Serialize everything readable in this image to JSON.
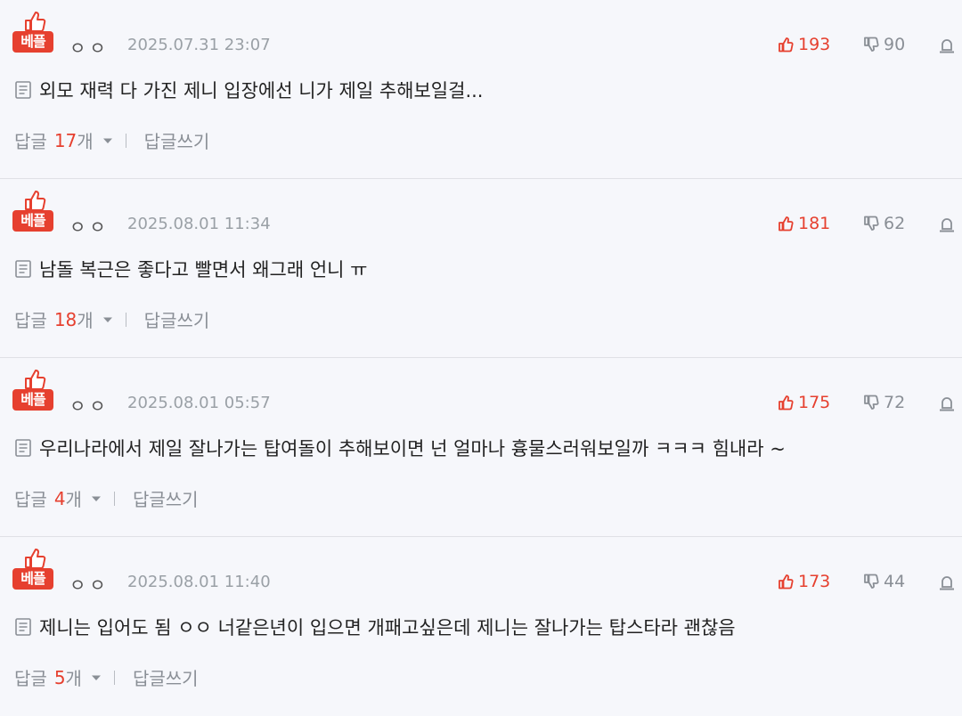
{
  "badge_label": "베플",
  "reply_label": "답글",
  "reply_unit": "개",
  "write_reply_label": "답글쓰기",
  "icons": {
    "best": "thumbs-up-icon",
    "like": "thumbs-up-icon",
    "dislike": "thumbs-down-icon",
    "report": "siren-icon",
    "memo": "memo-icon",
    "chevron": "chevron-down-icon"
  },
  "colors": {
    "accent": "#e6402f",
    "muted": "#8a8f96",
    "background": "#f6f7fb"
  },
  "comments": [
    {
      "author": "ㅇㅇ",
      "date": "2025.07.31 23:07",
      "likes": "193",
      "dislikes": "90",
      "text": "외모 재력 다 가진 제니 입장에선 니가 제일 추해보일걸...",
      "reply_count": "17"
    },
    {
      "author": "ㅇㅇ",
      "date": "2025.08.01 11:34",
      "likes": "181",
      "dislikes": "62",
      "text": "남돌 복근은 좋다고 빨면서 왜그래 언니 ㅠ",
      "reply_count": "18"
    },
    {
      "author": "ㅇㅇ",
      "date": "2025.08.01 05:57",
      "likes": "175",
      "dislikes": "72",
      "text": "우리나라에서 제일 잘나가는 탑여돌이 추해보이면 넌 얼마나 흉물스러워보일까 ㅋㅋㅋ 힘내라 ~",
      "reply_count": "4"
    },
    {
      "author": "ㅇㅇ",
      "date": "2025.08.01 11:40",
      "likes": "173",
      "dislikes": "44",
      "text": "제니는 입어도 됨 ㅇㅇ 너같은년이 입으면 개패고싶은데 제니는 잘나가는 탑스타라 괜찮음",
      "reply_count": "5"
    }
  ]
}
